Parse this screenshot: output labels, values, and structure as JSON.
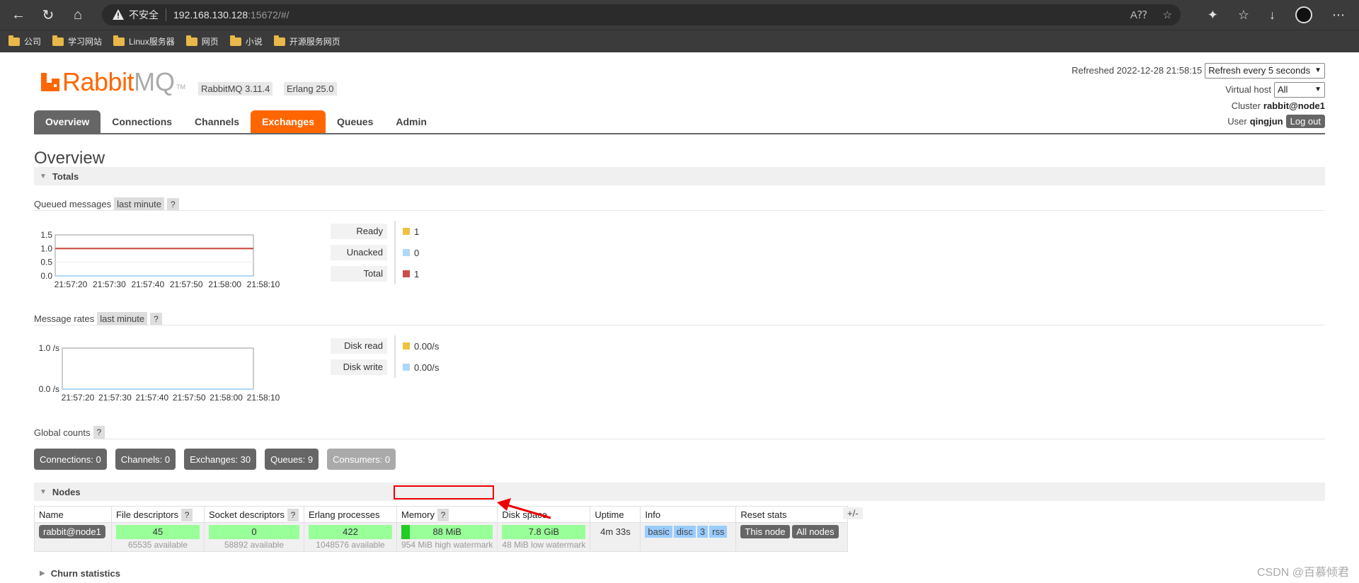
{
  "browser": {
    "insecure_label": "不安全",
    "url_host": "192.168.130.128",
    "url_rest": ":15672/#/",
    "bookmarks": [
      "公司",
      "学习网站",
      "Linux服务器",
      "网页",
      "小说",
      "开源服务网页"
    ]
  },
  "header": {
    "brand_rabbit": "Rabbit",
    "brand_mq": "MQ",
    "brand_tm": "TM",
    "version": "RabbitMQ 3.11.4",
    "erlang": "Erlang 25.0",
    "refreshed_label": "Refreshed 2022-12-28 21:58:15",
    "refresh_select": "Refresh every 5 seconds",
    "vhost_label": "Virtual host",
    "vhost_select": "All",
    "cluster_label": "Cluster",
    "cluster_value": "rabbit@node1",
    "user_label": "User",
    "user_value": "qingjun",
    "logout": "Log out"
  },
  "tabs": [
    "Overview",
    "Connections",
    "Channels",
    "Exchanges",
    "Queues",
    "Admin"
  ],
  "page_title": "Overview",
  "totals": {
    "section": "Totals",
    "queued_title": "Queued messages",
    "queued_chip": "last minute",
    "rates_title": "Message rates",
    "rates_chip": "last minute",
    "qmark": "?",
    "queued_legend": [
      {
        "label": "Ready",
        "value": "1",
        "color": "#edc240"
      },
      {
        "label": "Unacked",
        "value": "0",
        "color": "#afd8f8"
      },
      {
        "label": "Total",
        "value": "1",
        "color": "#cb4b4b"
      }
    ],
    "rates_legend": [
      {
        "label": "Disk read",
        "value": "0.00/s",
        "color": "#edc240"
      },
      {
        "label": "Disk write",
        "value": "0.00/s",
        "color": "#afd8f8"
      }
    ]
  },
  "chart_data": [
    {
      "type": "line",
      "title": "Queued messages",
      "x": [
        "21:57:20",
        "21:57:30",
        "21:57:40",
        "21:57:50",
        "21:58:00",
        "21:58:10"
      ],
      "ylim": [
        0,
        1.5
      ],
      "yticks": [
        "1.5",
        "1.0",
        "0.5",
        "0.0"
      ],
      "series": [
        {
          "name": "Ready",
          "values": [
            1,
            1,
            1,
            1,
            1,
            1
          ]
        },
        {
          "name": "Unacked",
          "values": [
            0,
            0,
            0,
            0,
            0,
            0
          ]
        },
        {
          "name": "Total",
          "values": [
            1,
            1,
            1,
            1,
            1,
            1
          ]
        }
      ]
    },
    {
      "type": "line",
      "title": "Message rates",
      "x": [
        "21:57:20",
        "21:57:30",
        "21:57:40",
        "21:57:50",
        "21:58:00",
        "21:58:10"
      ],
      "ylim": [
        0,
        1
      ],
      "yticks": [
        "1.0 /s",
        "0.0 /s"
      ],
      "series": [
        {
          "name": "Disk read",
          "values": [
            0,
            0,
            0,
            0,
            0,
            0
          ]
        },
        {
          "name": "Disk write",
          "values": [
            0,
            0,
            0,
            0,
            0,
            0
          ]
        }
      ]
    }
  ],
  "global_counts": {
    "title": "Global counts",
    "items": [
      {
        "label": "Connections: 0"
      },
      {
        "label": "Channels: 0"
      },
      {
        "label": "Exchanges: 30"
      },
      {
        "label": "Queues: 9"
      },
      {
        "label": "Consumers: 0"
      }
    ]
  },
  "nodes": {
    "section": "Nodes",
    "headers": [
      "Name",
      "File descriptors",
      "Socket descriptors",
      "Erlang processes",
      "Memory",
      "Disk space",
      "Uptime",
      "Info",
      "Reset stats"
    ],
    "plusminus": "+/-",
    "row": {
      "name": "rabbit@node1",
      "fd": "45",
      "fd_sub": "65535 available",
      "sock": "0",
      "sock_sub": "58892 available",
      "erl": "422",
      "erl_sub": "1048576 available",
      "mem": "88 MiB",
      "mem_sub": "954 MiB high watermark",
      "mem_fraction": 0.09,
      "disk": "7.8 GiB",
      "disk_sub": "48 MiB low watermark",
      "uptime": "4m 33s",
      "info_tags": [
        "basic",
        "disc",
        "3",
        "rss"
      ],
      "reset_this": "This node",
      "reset_all": "All nodes"
    }
  },
  "churn": {
    "section": "Churn statistics"
  },
  "watermark": "CSDN @百慕倾君"
}
